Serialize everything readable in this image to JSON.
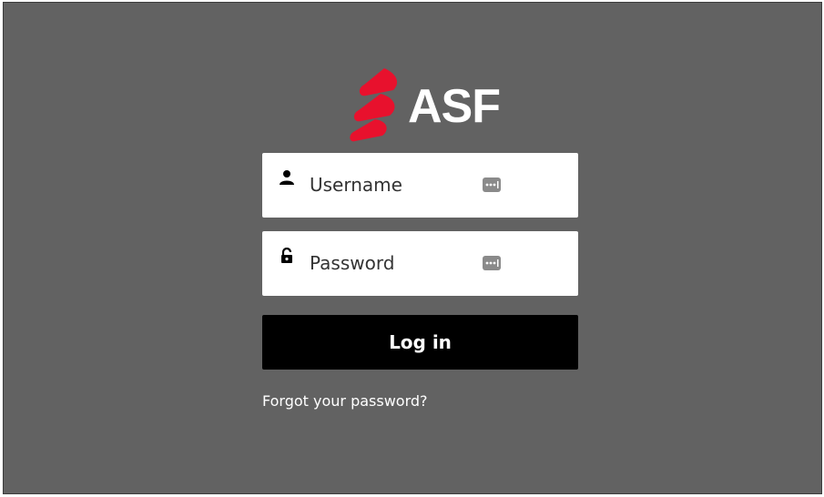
{
  "logo": {
    "text": "ASF",
    "icon": "asf-flame-logo",
    "accent_color": "#e8112d"
  },
  "form": {
    "username": {
      "placeholder": "Username",
      "value": "",
      "icon": "user-icon",
      "trailing_icon": "password-manager-key-icon"
    },
    "password": {
      "placeholder": "Password",
      "value": "",
      "icon": "lock-icon",
      "trailing_icon": "password-manager-key-icon"
    },
    "login_label": "Log in",
    "forgot_label": "Forgot your password?"
  },
  "colors": {
    "background": "#626262",
    "field_bg": "#ffffff",
    "button_bg": "#000000",
    "text_light": "#ffffff"
  }
}
